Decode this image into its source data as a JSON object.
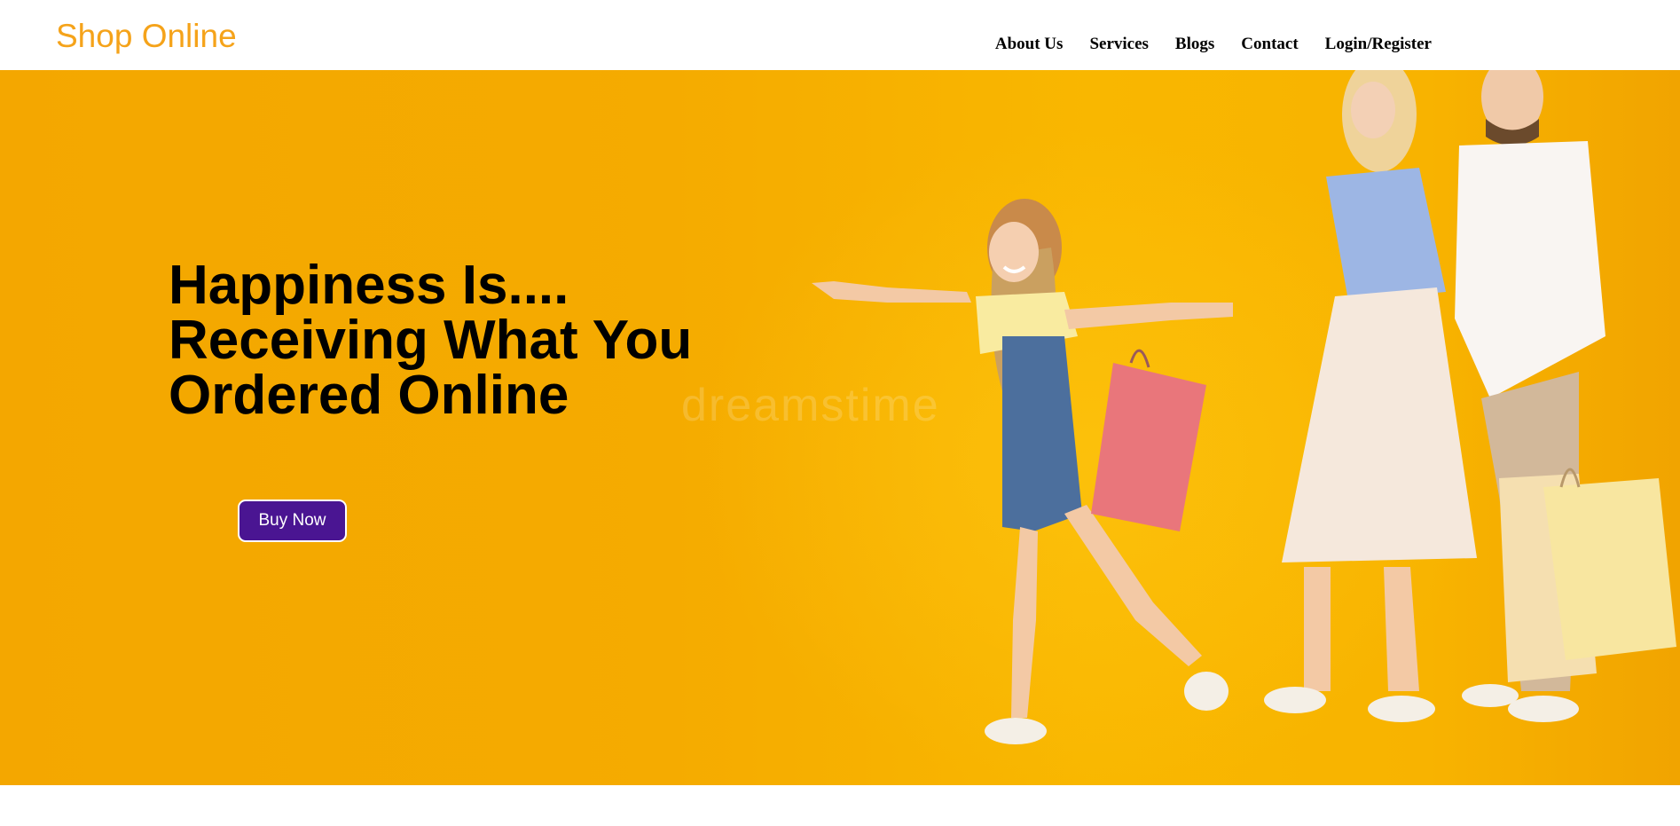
{
  "navbar": {
    "logo": "Shop Online",
    "links": [
      {
        "label": "About Us"
      },
      {
        "label": "Services"
      },
      {
        "label": "Blogs"
      },
      {
        "label": "Contact"
      },
      {
        "label": "Login/Register"
      }
    ]
  },
  "hero": {
    "headline_lines": [
      "Happiness Is....",
      "Receiving What You",
      "Ordered Online"
    ],
    "cta_label": "Buy Now",
    "watermark": "dreamstime",
    "image_description_icon": "family-shopping-photo",
    "background_color": "#f5ab00",
    "cta_color": "#4a1592",
    "logo_color": "#f5a31a"
  }
}
